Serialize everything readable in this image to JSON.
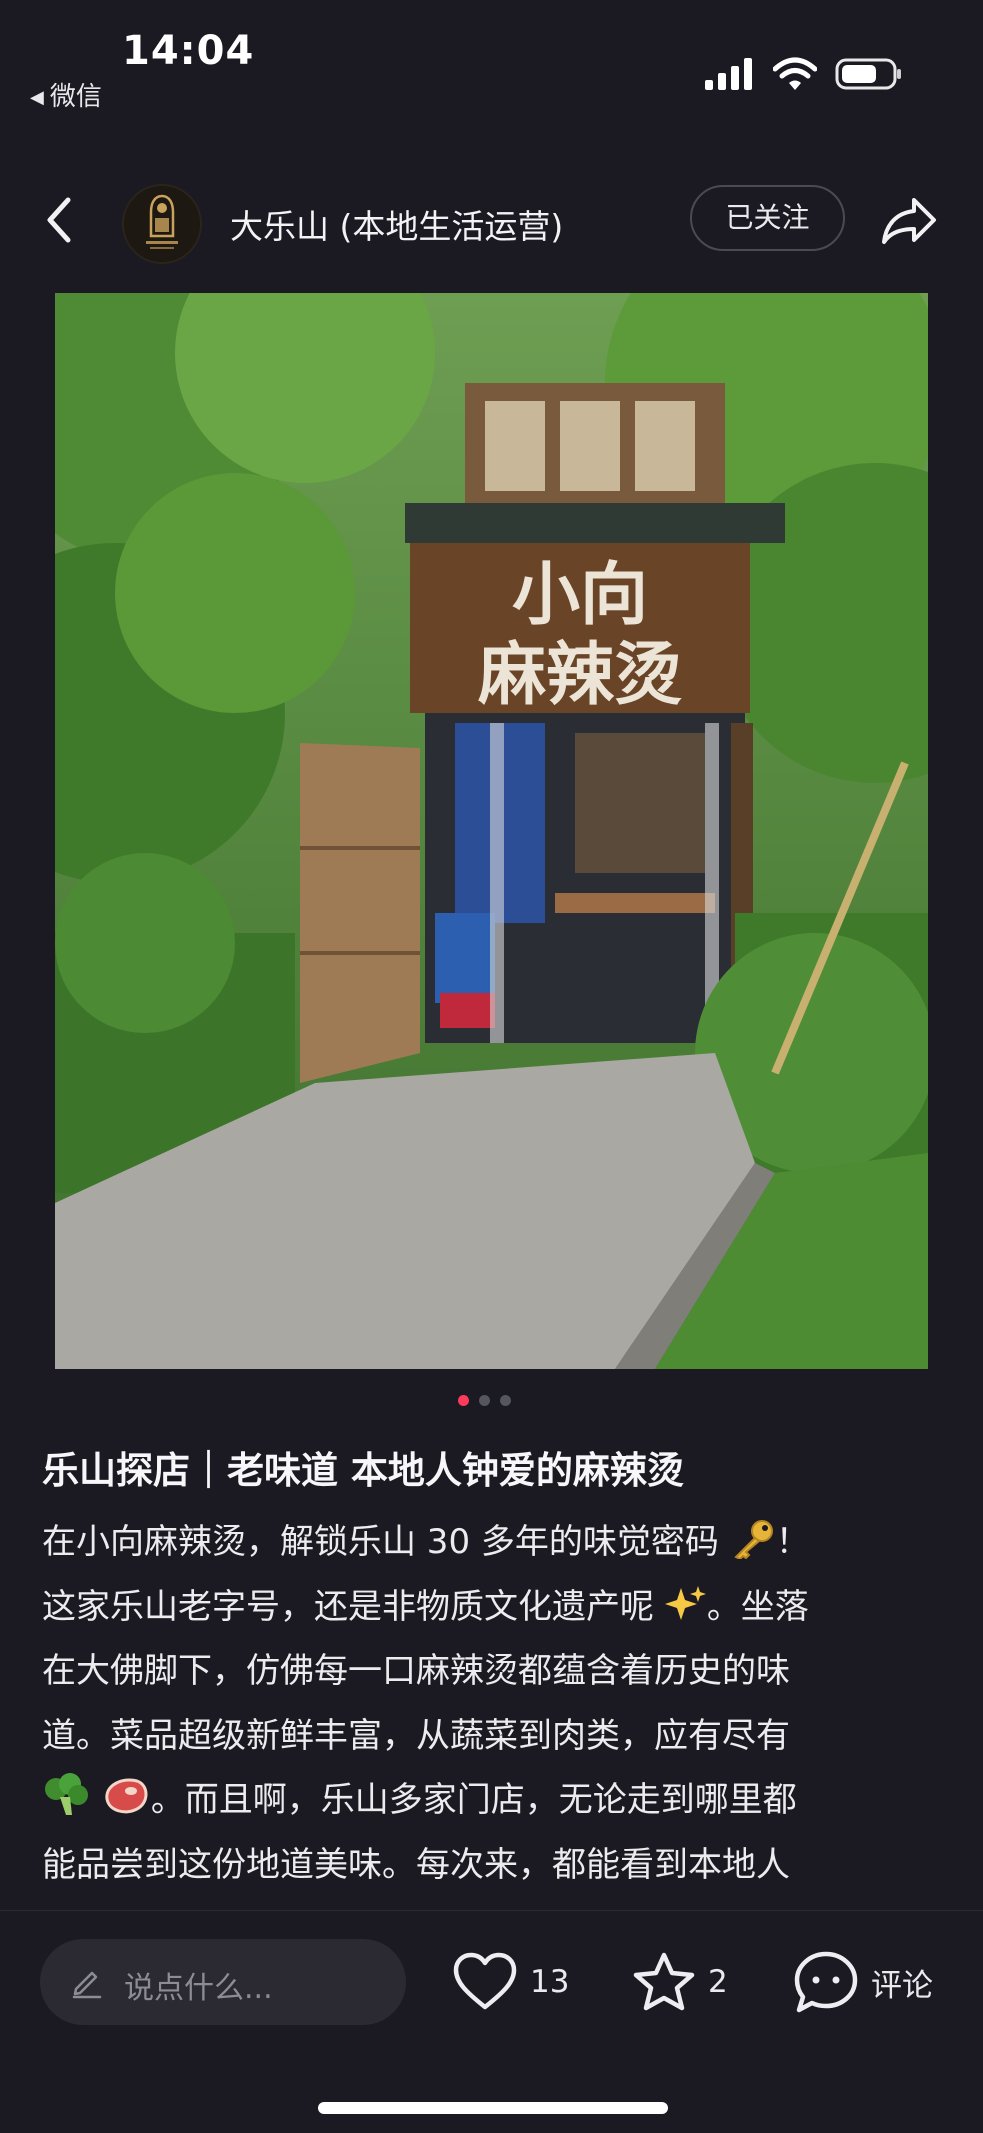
{
  "status_bar": {
    "time": "14:04",
    "back_app": "微信",
    "icons": [
      "cellular-signal-icon",
      "wifi-icon",
      "battery-icon"
    ]
  },
  "nav": {
    "account_name": "大乐山 (本地生活运营)",
    "follow_label": "已关注",
    "icons": [
      "back-arrow-icon",
      "share-icon"
    ]
  },
  "photo": {
    "sign_line1": "小向",
    "sign_line2": "麻辣烫",
    "carousel_index": 1,
    "carousel_total": 3
  },
  "post": {
    "title": "乐山探店｜老味道 本地人钟爱的麻辣烫",
    "lines": [
      "在小向麻辣烫，解锁乐山 30 多年的味觉密码",
      "！",
      "这家乐山老字号，还是非物质文化遗产呢",
      "。坐落",
      "在大佛脚下，仿佛每一口麻辣烫都蕴含着历史的味",
      "道。菜品超级新鲜丰富，从蔬菜到肉类，应有尽有",
      "。而且啊，乐山多家门店，无论走到哪里都",
      "能品尝到这份地道美味。每次来，都能看到本地人"
    ],
    "emoji_names": [
      "key-emoji",
      "sparkles-emoji",
      "broccoli-emoji",
      "meat-emoji"
    ]
  },
  "bottom_bar": {
    "comment_placeholder": "说点什么...",
    "like_count": "13",
    "favorite_count": "2",
    "comment_label": "评论"
  },
  "colors": {
    "background": "#1b1a22",
    "input_background": "#2b2a33",
    "carousel_active": "#ff3b5c"
  }
}
